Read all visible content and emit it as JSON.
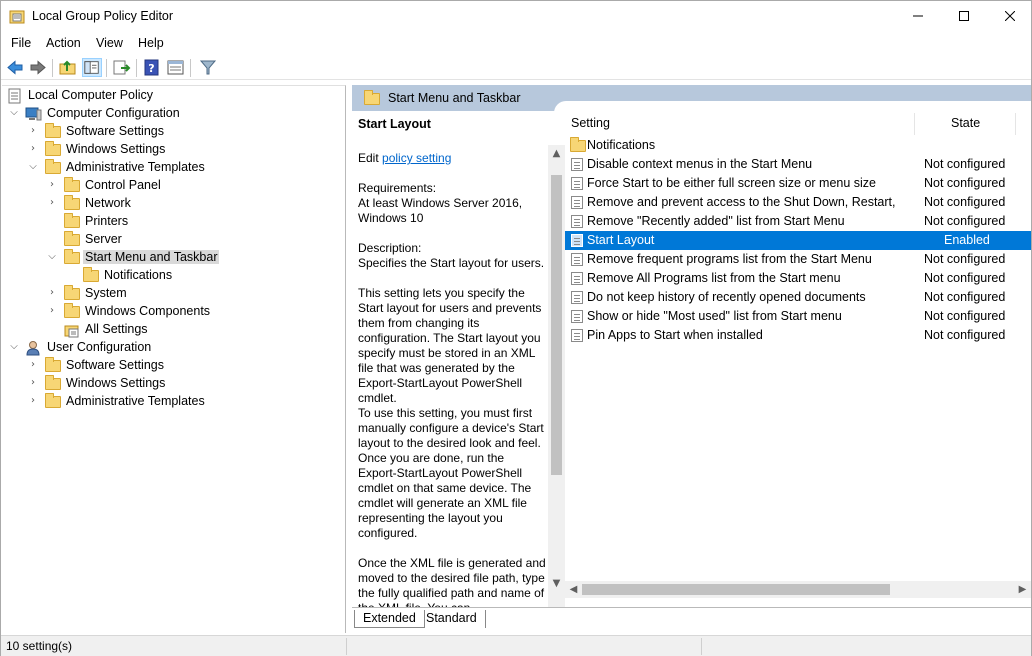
{
  "window": {
    "title": "Local Group Policy Editor"
  },
  "menu": [
    "File",
    "Action",
    "View",
    "Help"
  ],
  "tree": [
    {
      "label": "Local Computer Policy",
      "icon": "local-policy-icon"
    },
    {
      "label": "Computer Configuration",
      "icon": "computer-icon"
    },
    {
      "label": "Software Settings",
      "icon": "folder-icon"
    },
    {
      "label": "Windows Settings",
      "icon": "folder-icon"
    },
    {
      "label": "Administrative Templates",
      "icon": "folder-icon"
    },
    {
      "label": "Control Panel",
      "icon": "folder-icon"
    },
    {
      "label": "Network",
      "icon": "folder-icon"
    },
    {
      "label": "Printers",
      "icon": "folder-icon"
    },
    {
      "label": "Server",
      "icon": "folder-icon"
    },
    {
      "label": "Start Menu and Taskbar",
      "icon": "folder-icon"
    },
    {
      "label": "Notifications",
      "icon": "folder-icon"
    },
    {
      "label": "System",
      "icon": "folder-icon"
    },
    {
      "label": "Windows Components",
      "icon": "folder-icon"
    },
    {
      "label": "All Settings",
      "icon": "all-settings-icon"
    },
    {
      "label": "User Configuration",
      "icon": "user-icon"
    },
    {
      "label": "Software Settings",
      "icon": "folder-icon"
    },
    {
      "label": "Windows Settings",
      "icon": "folder-icon"
    },
    {
      "label": "Administrative Templates",
      "icon": "folder-icon"
    }
  ],
  "header": {
    "title": "Start Menu and Taskbar"
  },
  "description": {
    "title": "Start Layout",
    "edit_prefix": "Edit",
    "edit_link": "policy setting",
    "requirements_label": "Requirements:",
    "requirements": "At least Windows Server 2016, Windows 10",
    "description_label": "Description:",
    "description": "Specifies the Start layout for users.",
    "body1": "This setting lets you specify the Start layout for users and prevents them from changing its configuration. The Start layout you specify must be stored in an XML file that was generated by the Export-StartLayout PowerShell cmdlet.",
    "body2": "To use this setting, you must first manually configure a device's Start layout to the desired look and feel. Once you are done, run the Export-StartLayout PowerShell cmdlet on that same device. The cmdlet will generate an XML file representing the layout you configured.",
    "body3": "Once the XML file is generated and moved to the desired file path, type the fully qualified path and name of the XML file. You can"
  },
  "list": {
    "columns": {
      "setting": "Setting",
      "state": "State"
    },
    "rows": [
      {
        "name": "Notifications",
        "state": "",
        "type": "folder"
      },
      {
        "name": "Disable context menus in the Start Menu",
        "state": "Not configured",
        "type": "setting"
      },
      {
        "name": "Force Start to be either full screen size or menu size",
        "state": "Not configured",
        "type": "setting"
      },
      {
        "name": "Remove and prevent access to the Shut Down, Restart, Sleep...",
        "state": "Not configured",
        "type": "setting"
      },
      {
        "name": "Remove \"Recently added\" list from Start Menu",
        "state": "Not configured",
        "type": "setting"
      },
      {
        "name": "Start Layout",
        "state": "Enabled",
        "type": "setting",
        "selected": true
      },
      {
        "name": "Remove frequent programs list from the Start Menu",
        "state": "Not configured",
        "type": "setting"
      },
      {
        "name": "Remove All Programs list from the Start menu",
        "state": "Not configured",
        "type": "setting"
      },
      {
        "name": "Do not keep history of recently opened documents",
        "state": "Not configured",
        "type": "setting"
      },
      {
        "name": "Show or hide \"Most used\" list from Start menu",
        "state": "Not configured",
        "type": "setting"
      },
      {
        "name": "Pin Apps to Start when installed",
        "state": "Not configured",
        "type": "setting"
      }
    ]
  },
  "tabs": [
    "Extended",
    "Standard"
  ],
  "status": {
    "text": "10 setting(s)"
  },
  "colors": {
    "selection": "#0078d7",
    "header_band": "#b7c8dc",
    "folder": "#f7d675",
    "link": "#0066cc"
  }
}
